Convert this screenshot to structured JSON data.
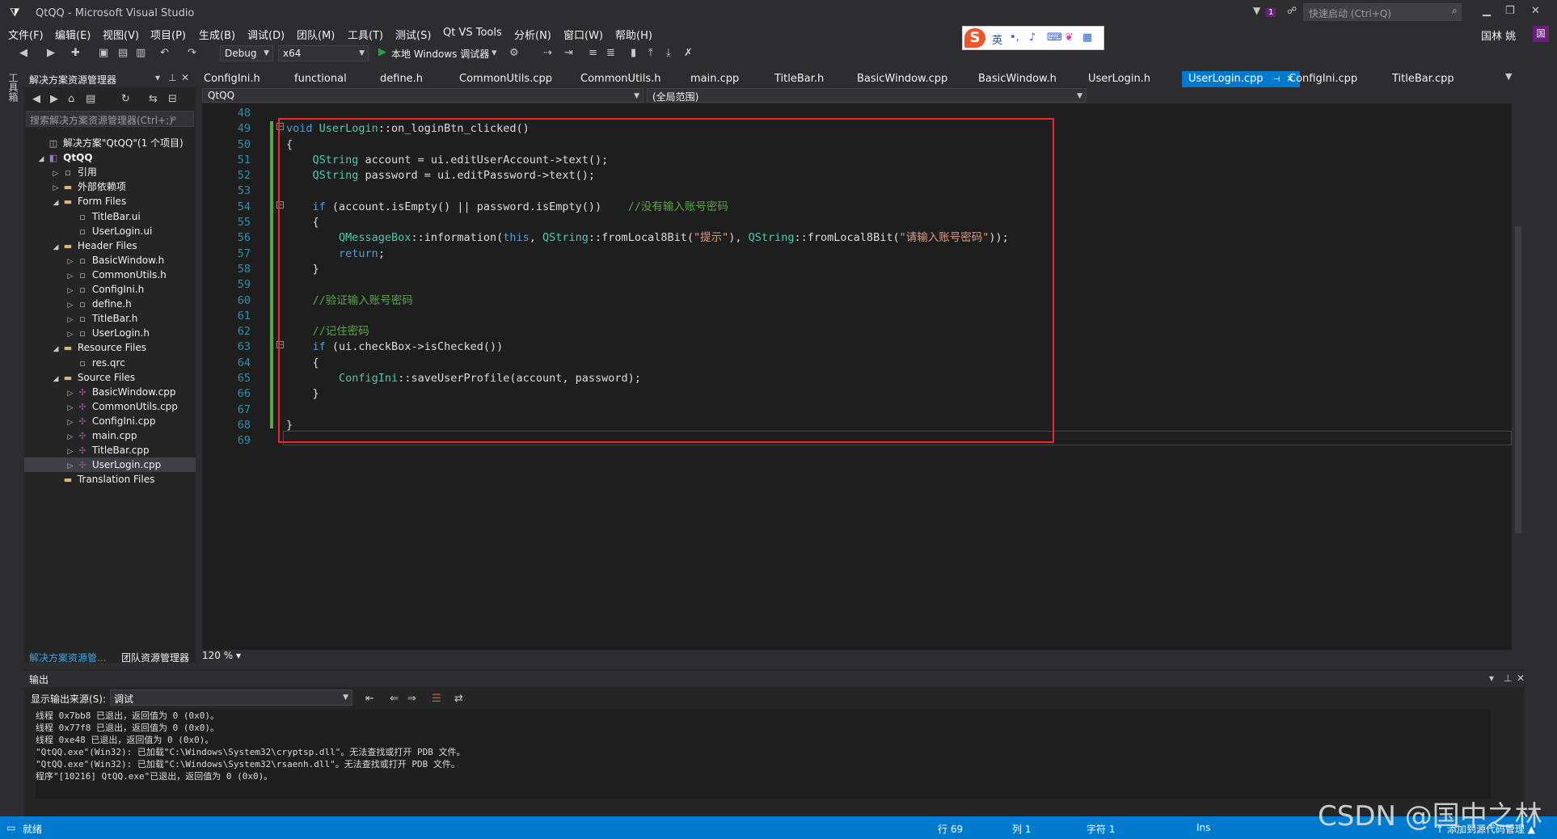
{
  "window": {
    "title": "QtQQ - Microsoft Visual Studio",
    "quick_launch_placeholder": "快速启动 (Ctrl+Q)",
    "notification_count": "1",
    "user_name": "国林 姚",
    "user_initials": "国"
  },
  "menu": [
    "文件(F)",
    "编辑(E)",
    "视图(V)",
    "项目(P)",
    "生成(B)",
    "调试(D)",
    "团队(M)",
    "工具(T)",
    "测试(S)",
    "Qt VS Tools",
    "分析(N)",
    "窗口(W)",
    "帮助(H)"
  ],
  "ime": {
    "mode": "英"
  },
  "toolbar": {
    "config": "Debug",
    "platform": "x64",
    "run_label": "本地 Windows 调试器"
  },
  "left_strip": {
    "label": "工具箱"
  },
  "solution_explorer": {
    "title": "解决方案资源管理器",
    "search_placeholder": "搜索解决方案资源管理器(Ctrl+;)",
    "tree": [
      {
        "label": "解决方案\"QtQQ\"(1 个项目)",
        "level": 0,
        "icon": "sol",
        "expand": ""
      },
      {
        "label": "QtQQ",
        "level": 0,
        "icon": "proj",
        "expand": "open",
        "bold": true
      },
      {
        "label": "引用",
        "level": 1,
        "icon": "file",
        "expand": "closed"
      },
      {
        "label": "外部依赖项",
        "level": 1,
        "icon": "folder",
        "expand": "closed"
      },
      {
        "label": "Form Files",
        "level": 1,
        "icon": "folder",
        "expand": "open"
      },
      {
        "label": "TitleBar.ui",
        "level": 2,
        "icon": "file",
        "expand": ""
      },
      {
        "label": "UserLogin.ui",
        "level": 2,
        "icon": "file",
        "expand": ""
      },
      {
        "label": "Header Files",
        "level": 1,
        "icon": "folder",
        "expand": "open"
      },
      {
        "label": "BasicWindow.h",
        "level": 2,
        "icon": "file",
        "expand": "closed"
      },
      {
        "label": "CommonUtils.h",
        "level": 2,
        "icon": "file",
        "expand": "closed"
      },
      {
        "label": "ConfigIni.h",
        "level": 2,
        "icon": "file",
        "expand": "closed"
      },
      {
        "label": "define.h",
        "level": 2,
        "icon": "file",
        "expand": "closed"
      },
      {
        "label": "TitleBar.h",
        "level": 2,
        "icon": "file",
        "expand": "closed"
      },
      {
        "label": "UserLogin.h",
        "level": 2,
        "icon": "file",
        "expand": "closed"
      },
      {
        "label": "Resource Files",
        "level": 1,
        "icon": "folder",
        "expand": "open"
      },
      {
        "label": "res.qrc",
        "level": 2,
        "icon": "file",
        "expand": ""
      },
      {
        "label": "Source Files",
        "level": 1,
        "icon": "folder",
        "expand": "open"
      },
      {
        "label": "BasicWindow.cpp",
        "level": 2,
        "icon": "cpp",
        "expand": "closed"
      },
      {
        "label": "CommonUtils.cpp",
        "level": 2,
        "icon": "cpp",
        "expand": "closed"
      },
      {
        "label": "ConfigIni.cpp",
        "level": 2,
        "icon": "cpp",
        "expand": "closed"
      },
      {
        "label": "main.cpp",
        "level": 2,
        "icon": "cpp",
        "expand": "closed"
      },
      {
        "label": "TitleBar.cpp",
        "level": 2,
        "icon": "cpp",
        "expand": "closed"
      },
      {
        "label": "UserLogin.cpp",
        "level": 2,
        "icon": "cpp",
        "expand": "closed",
        "selected": true
      },
      {
        "label": "Translation Files",
        "level": 1,
        "icon": "folder",
        "expand": ""
      }
    ],
    "bottom_tabs": [
      "解决方案资源管...",
      "团队资源管理器"
    ]
  },
  "doc_tabs": [
    "ConfigIni.h",
    "functional",
    "define.h",
    "CommonUtils.cpp",
    "CommonUtils.h",
    "main.cpp",
    "TitleBar.h",
    "BasicWindow.cpp",
    "BasicWindow.h",
    "UserLogin.h",
    "UserLogin.cpp",
    "ConfigIni.cpp",
    "TitleBar.cpp"
  ],
  "active_tab": "UserLogin.cpp",
  "nav": {
    "project": "QtQQ",
    "scope": "(全局范围)"
  },
  "editor": {
    "zoom": "120 %",
    "line_numbers": [
      "48",
      "49",
      "50",
      "51",
      "52",
      "53",
      "54",
      "55",
      "56",
      "57",
      "58",
      "59",
      "60",
      "61",
      "62",
      "63",
      "64",
      "65",
      "66",
      "67",
      "68",
      "69"
    ],
    "lines": [
      [],
      [
        [
          "kw",
          "void "
        ],
        [
          "ty",
          "UserLogin"
        ],
        [
          "",
          "::on_loginBtn_clicked()"
        ]
      ],
      [
        [
          "",
          "{"
        ]
      ],
      [
        [
          "",
          "    "
        ],
        [
          "ty",
          "QString"
        ],
        [
          "",
          " account = ui.editUserAccount->text();"
        ]
      ],
      [
        [
          "",
          "    "
        ],
        [
          "ty",
          "QString"
        ],
        [
          "",
          " password = ui.editPassword->text();"
        ]
      ],
      [],
      [
        [
          "",
          "    "
        ],
        [
          "kw",
          "if"
        ],
        [
          "",
          " (account.isEmpty() || password.isEmpty())    "
        ],
        [
          "cm",
          "//没有输入账号密码"
        ]
      ],
      [
        [
          "",
          "    {"
        ]
      ],
      [
        [
          "",
          "        "
        ],
        [
          "ty",
          "QMessageBox"
        ],
        [
          "",
          "::information("
        ],
        [
          "kw",
          "this"
        ],
        [
          "",
          ", "
        ],
        [
          "ty",
          "QString"
        ],
        [
          "",
          "::fromLocal8Bit("
        ],
        [
          "st",
          "\"提示\""
        ],
        [
          "",
          "), "
        ],
        [
          "ty",
          "QString"
        ],
        [
          "",
          "::fromLocal8Bit("
        ],
        [
          "st",
          "\"请输入账号密码\""
        ],
        [
          "",
          "));"
        ]
      ],
      [
        [
          "",
          "        "
        ],
        [
          "kw",
          "return"
        ],
        [
          "",
          ";"
        ]
      ],
      [
        [
          "",
          "    }"
        ]
      ],
      [],
      [
        [
          "",
          "    "
        ],
        [
          "cm",
          "//验证输入账号密码"
        ]
      ],
      [],
      [
        [
          "",
          "    "
        ],
        [
          "cm",
          "//记住密码"
        ]
      ],
      [
        [
          "",
          "    "
        ],
        [
          "kw",
          "if"
        ],
        [
          "",
          " (ui.checkBox->isChecked())"
        ]
      ],
      [
        [
          "",
          "    {"
        ]
      ],
      [
        [
          "",
          "        "
        ],
        [
          "ty",
          "ConfigIni"
        ],
        [
          "",
          "::saveUserProfile(account, password);"
        ]
      ],
      [
        [
          "",
          "    }"
        ]
      ],
      [],
      [
        [
          "",
          "}"
        ]
      ],
      []
    ]
  },
  "output": {
    "title": "输出",
    "source_label": "显示输出来源(S):",
    "source_value": "调试",
    "lines": [
      "线程 0x7bb8 已退出，返回值为 0 (0x0)。",
      "线程 0x77f8 已退出，返回值为 0 (0x0)。",
      "线程 0xe48 已退出，返回值为 0 (0x0)。",
      "\"QtQQ.exe\"(Win32): 已加载\"C:\\Windows\\System32\\cryptsp.dll\"。无法查找或打开 PDB 文件。",
      "\"QtQQ.exe\"(Win32): 已加载\"C:\\Windows\\System32\\rsaenh.dll\"。无法查找或打开 PDB 文件。",
      "程序\"[10216] QtQQ.exe\"已退出，返回值为 0 (0x0)。"
    ]
  },
  "status": {
    "ready": "就绪",
    "line": "行 69",
    "col": "列 1",
    "char": "字符 1",
    "ins": "Ins",
    "source_control": "↑ 添加到源代码管理 ▲"
  },
  "watermark": "CSDN @国中之林",
  "colors": {
    "accent": "#007acc",
    "highlight_box": "#e82a2a",
    "keyword": "#569cd6",
    "type": "#4ec9b0",
    "comment": "#57a64a",
    "string": "#d69d85"
  }
}
